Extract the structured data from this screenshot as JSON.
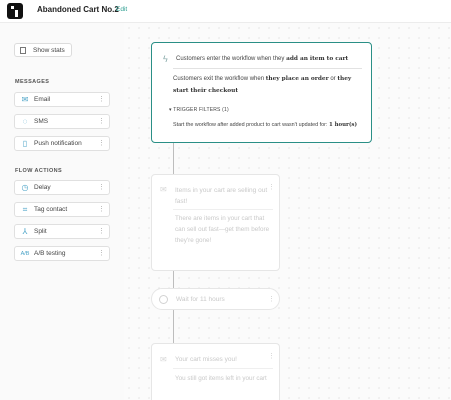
{
  "header": {
    "title": "Abandoned Cart No.2",
    "edit_label": "Edit"
  },
  "sidebar": {
    "show_stats_label": "Show stats",
    "messages_heading": "MESSAGES",
    "messages": [
      {
        "label": "Email",
        "icon": "mail-icon"
      },
      {
        "label": "SMS",
        "icon": "sms-icon"
      },
      {
        "label": "Push notification",
        "icon": "push-icon"
      }
    ],
    "flow_actions_heading": "FLOW ACTIONS",
    "flow_actions": [
      {
        "label": "Delay",
        "icon": "clock-icon"
      },
      {
        "label": "Tag contact",
        "icon": "tag-icon"
      },
      {
        "label": "Split",
        "icon": "split-icon"
      },
      {
        "label": "A/B testing",
        "icon": "ab-testing-icon"
      }
    ]
  },
  "workflow": {
    "trigger": {
      "enter_prefix": "Customers enter the workflow when they",
      "enter_event": "add an item to cart",
      "exit_prefix": "Customers exit the workflow when",
      "exit_event_1": "they place an order",
      "exit_or": "or",
      "exit_event_2": "they start their checkout",
      "filters_label": "TRIGGER FILTERS (1)",
      "filter_prefix": "Start the workflow after added product to cart wasn't updated for:",
      "filter_value": "1 hour(s)"
    },
    "email_1": {
      "subject": "Items in your cart are selling out fast!",
      "body": "There are items in your cart that can sell out fast—get them before they're gone!"
    },
    "wait": {
      "label": "Wait for 11 hours"
    },
    "email_2": {
      "subject": "Your cart misses you!",
      "body": "You still got items left in your cart"
    }
  },
  "colors": {
    "accent": "#2a8f86",
    "icon": "#4aa3c7"
  }
}
